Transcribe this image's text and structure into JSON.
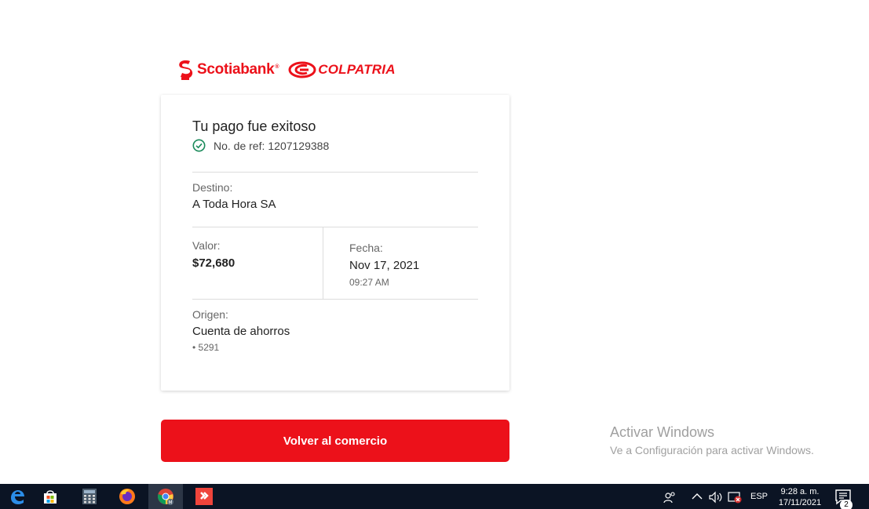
{
  "brand": {
    "scotiabank": "Scotiabank",
    "registered": "®",
    "colpatria": "COLPATRIA",
    "color": "#ec111a"
  },
  "receipt": {
    "title": "Tu pago fue exitoso",
    "ref_label": "No. de ref:",
    "ref_value": "1207129388",
    "destino_label": "Destino:",
    "destino_value": "A Toda Hora SA",
    "valor_label": "Valor:",
    "valor_value": "$72,680",
    "fecha_label": "Fecha:",
    "fecha_value": "Nov 17, 2021",
    "hora_value": "09:27 AM",
    "origen_label": "Origen:",
    "origen_value": "Cuenta de ahorros",
    "origen_account": "• 5291",
    "status_color": "#1a8a5a"
  },
  "actions": {
    "volver_label": "Volver al comercio"
  },
  "watermark": {
    "title": "Activar Windows",
    "subtitle": "Ve a Configuración para activar Windows."
  },
  "taskbar": {
    "icons": [
      "edge-icon",
      "store-icon",
      "calculator-icon",
      "firefox-icon",
      "chrome-icon",
      "anydesk-icon"
    ],
    "language": "ESP",
    "time": "9:28 a. m.",
    "date": "17/11/2021",
    "notification_count": "2"
  }
}
